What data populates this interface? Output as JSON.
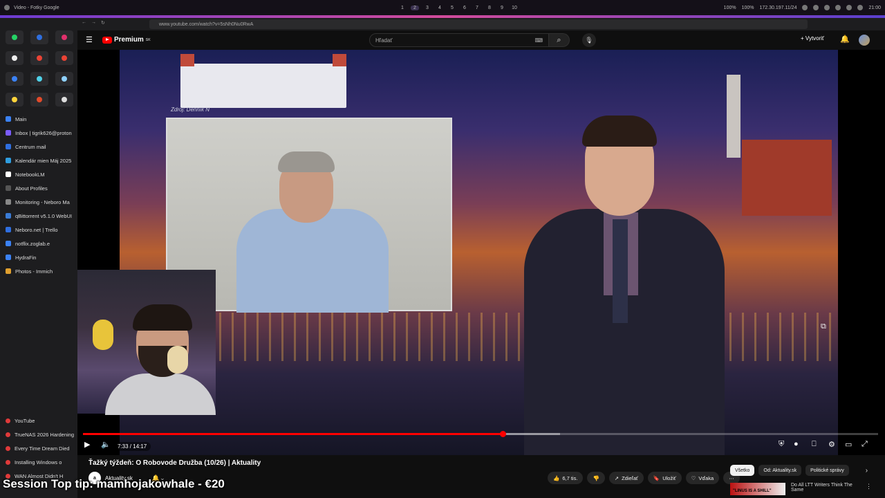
{
  "topbar": {
    "window_title": "Video - Fotky Google",
    "workspaces": [
      "1",
      "2",
      "3",
      "4",
      "5",
      "6",
      "7",
      "8",
      "9",
      "10"
    ],
    "status": [
      "100%",
      "100%",
      "172.30.197.11/24"
    ],
    "clock": "21:00"
  },
  "browser": {
    "url": "www.youtube.com/watch?v=5sNh0Nu0RwA"
  },
  "sidebar": {
    "bookmarks": [
      {
        "label": "Main",
        "color": "#3b82f6"
      },
      {
        "label": "Inbox | tigrik626@proton",
        "color": "#7b5cff"
      },
      {
        "label": "Centrum mail",
        "color": "#2f6fe0"
      },
      {
        "label": "Kalendár mien Máj 2025",
        "color": "#2f9ee0"
      },
      {
        "label": "NotebookLM",
        "color": "#ffffff"
      },
      {
        "label": "About Profiles",
        "color": "#555555"
      },
      {
        "label": "Monitoring - Neboro Ma",
        "color": "#888888"
      },
      {
        "label": "qBittorrent v5.1.0 WebUI",
        "color": "#3a7bd5"
      },
      {
        "label": "Neboro.net | Trello",
        "color": "#2f6fe0"
      },
      {
        "label": "notflix.zoglab.e",
        "color": "#3b82f6"
      },
      {
        "label": "HydraFin",
        "color": "#3b82f6"
      },
      {
        "label": "Photos - Immich",
        "color": "#e0a02f"
      }
    ],
    "lower_bookmarks": [
      {
        "label": "YouTube"
      },
      {
        "label": "TrueNAS 2026 Hardening"
      },
      {
        "label": "Every Time Dream Died"
      },
      {
        "label": "Installing Windows o"
      },
      {
        "label": "WAN Almost Didn't H"
      }
    ]
  },
  "youtube": {
    "logo_text": "Premium",
    "logo_badge": "SK",
    "search_placeholder": "Hľadať",
    "create_label": "Vytvoriť",
    "video": {
      "source_caption": "Zdroj: Denník N",
      "time": "7:33 / 14:17",
      "progress": 0.528
    },
    "title": "Ťažký týždeň: O Robovode Družba (10/26) | Aktuality",
    "channel": {
      "name": "Aktuality.sk",
      "avatar_text": "a"
    },
    "actions": {
      "likes": "6,7 tis.",
      "share": "Zdieľať",
      "save": "Uložiť",
      "thanks": "Vďaka"
    },
    "chips": [
      "Všetko",
      "Od: Aktuality.sk",
      "Politické správy"
    ],
    "recommendation": {
      "thumb_text": "\"LINUS IS A SHILL\"",
      "title": "Do All LTT Writers Think The Same"
    }
  },
  "overlay_text": "Session Top tip: mamhojakowhale - €20"
}
